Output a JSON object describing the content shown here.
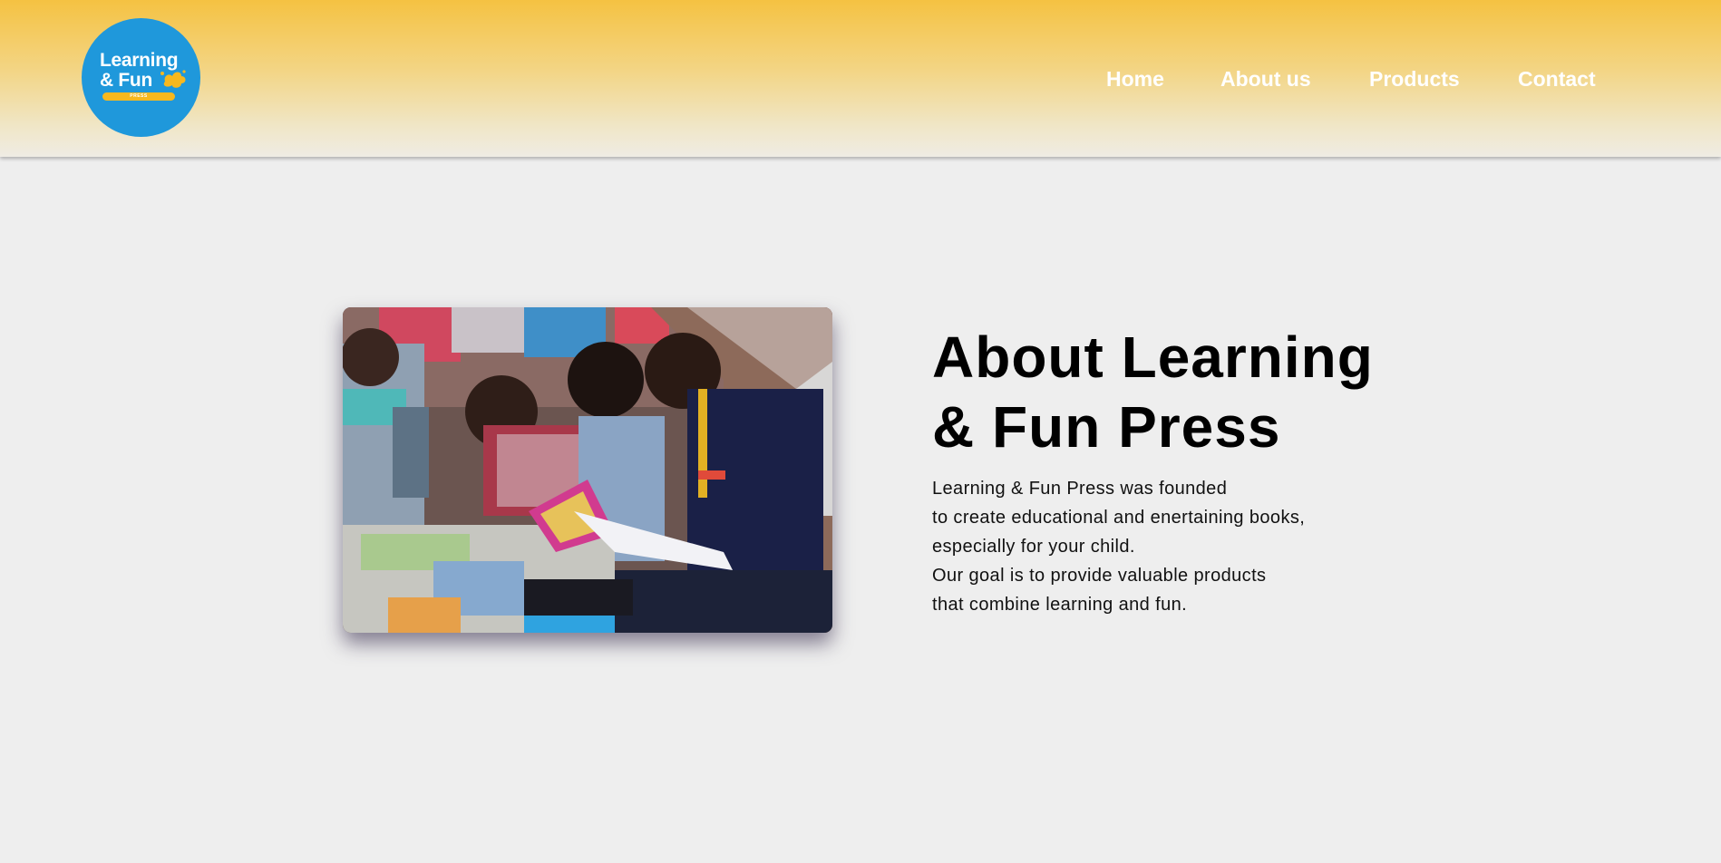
{
  "header": {
    "logo": {
      "line1": "Learning",
      "line2": "& Fun",
      "tagline": "PRESS",
      "color": "#1f98db",
      "accent": "#f7b81e"
    },
    "nav": {
      "home": "Home",
      "about": "About us",
      "products": "Products",
      "contact": "Contact"
    },
    "gradient_top": "#f5c242"
  },
  "main": {
    "photo": {
      "icon": "photo-children-reading"
    },
    "heading": {
      "line1": "About Learning",
      "line2": "& Fun Press"
    },
    "description": {
      "lines": [
        "Learning & Fun Press was founded",
        "to create educational and enertaining books,",
        "especially for your child.",
        "Our goal is to provide valuable products",
        "that combine learning and fun."
      ]
    }
  }
}
